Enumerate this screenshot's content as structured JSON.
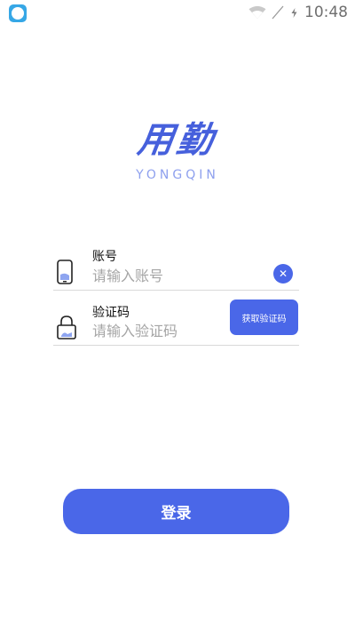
{
  "status_bar": {
    "time": "10:48",
    "icons": [
      "app-badge-icon",
      "wifi-icon",
      "no-signal-icon",
      "battery-charging-icon"
    ]
  },
  "logo": {
    "title": "用勤",
    "subtitle": "YONGQIN"
  },
  "account": {
    "label": "账号",
    "placeholder": "请输入账号",
    "value": "",
    "icon": "phone-icon",
    "clear_icon": "clear-icon"
  },
  "code": {
    "label": "验证码",
    "placeholder": "请输入验证码",
    "value": "",
    "icon": "lock-icon",
    "button_label": "获取验证码"
  },
  "login": {
    "label": "登录"
  },
  "colors": {
    "accent": "#4a67e8",
    "logo": "#4660dc",
    "logo_sub": "#8ea0ee",
    "divider": "#d9d9d9",
    "placeholder": "#a5a5a5"
  }
}
